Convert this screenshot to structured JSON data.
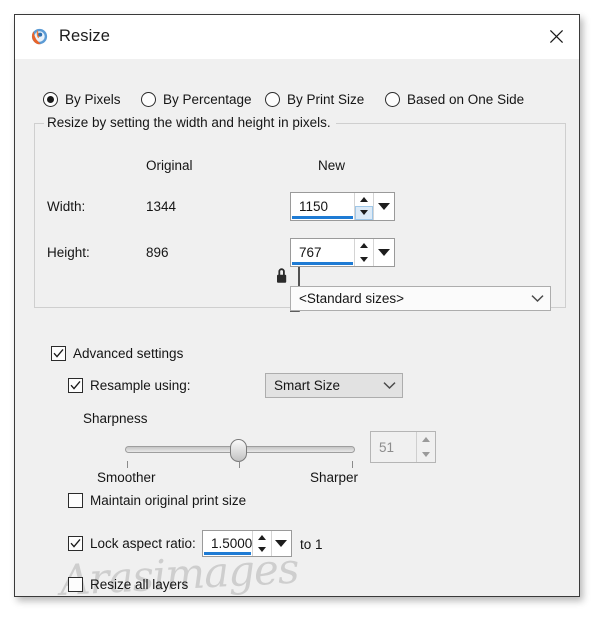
{
  "window": {
    "title": "Resize",
    "app_icon": "paintshop-pro-icon",
    "close_label": "×"
  },
  "resize_mode": {
    "options": [
      {
        "label": "By Pixels",
        "selected": true
      },
      {
        "label": "By Percentage",
        "selected": false
      },
      {
        "label": "By Print Size",
        "selected": false
      },
      {
        "label": "Based on One Side",
        "selected": false
      }
    ]
  },
  "pixel_group": {
    "legend": "Resize by setting the width and height in pixels.",
    "column_headers": {
      "original": "Original",
      "new": "New"
    },
    "width": {
      "label": "Width:",
      "original": "1344",
      "new": "1150"
    },
    "height": {
      "label": "Height:",
      "original": "896",
      "new": "767"
    },
    "link_icon": "lock-closed-icon",
    "standard_sizes": {
      "value": "<Standard sizes>",
      "icon": "chevron-down-icon"
    }
  },
  "advanced": {
    "label": "Advanced settings",
    "checked": true,
    "resample": {
      "label": "Resample using:",
      "checked": true,
      "value": "Smart Size",
      "icon": "chevron-down-icon"
    },
    "sharpness": {
      "label": "Sharpness",
      "min_label": "Smoother",
      "max_label": "Sharper",
      "value": "51",
      "thumb_percent": 46,
      "enabled": false
    },
    "maintain_print_size": {
      "label": "Maintain original print size",
      "checked": false
    },
    "lock_aspect_ratio": {
      "label": "Lock aspect ratio:",
      "checked": true,
      "value": "1.5000",
      "suffix": "to 1"
    },
    "resize_all_layers": {
      "label": "Resize all layers",
      "checked": false
    }
  },
  "watermark": {
    "text": "Arasimages"
  },
  "colors": {
    "accent": "#1e7bd4",
    "dialog_bg": "#f0f0f0",
    "titlebar_bg": "#ffffff",
    "border": "#3a3a3a",
    "text": "#151515",
    "disabled_text": "#8d8d8d"
  }
}
